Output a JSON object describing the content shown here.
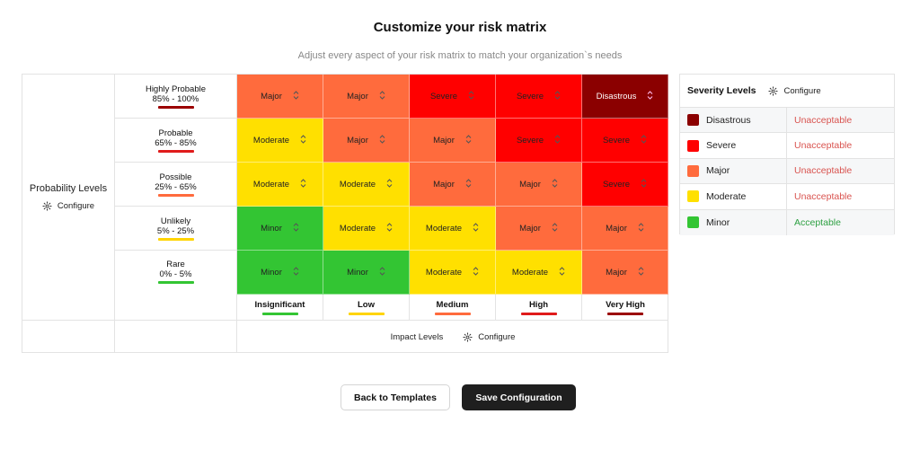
{
  "header": {
    "title": "Customize your risk matrix",
    "subtitle": "Adjust every aspect of your risk matrix to match your organization`s needs"
  },
  "colors": {
    "Disastrous": "#8b0000",
    "Severe": "#ff0000",
    "Major": "#ff6b3d",
    "Moderate": "#ffe000",
    "Minor": "#33c533"
  },
  "probability": {
    "title": "Probability Levels",
    "configure": "Configure",
    "levels": [
      {
        "name": "Highly Probable",
        "range": "85% - 100%",
        "color": "#9b0000"
      },
      {
        "name": "Probable",
        "range": "65% - 85%",
        "color": "#e01b1b"
      },
      {
        "name": "Possible",
        "range": "25% - 65%",
        "color": "#ff6b3d"
      },
      {
        "name": "Unlikely",
        "range": "5% - 25%",
        "color": "#ffd400"
      },
      {
        "name": "Rare",
        "range": "0% - 5%",
        "color": "#33c533"
      }
    ]
  },
  "matrix": {
    "rows": [
      [
        "Major",
        "Major",
        "Severe",
        "Severe",
        "Disastrous"
      ],
      [
        "Moderate",
        "Major",
        "Major",
        "Severe",
        "Severe"
      ],
      [
        "Moderate",
        "Moderate",
        "Major",
        "Major",
        "Severe"
      ],
      [
        "Minor",
        "Moderate",
        "Moderate",
        "Major",
        "Major"
      ],
      [
        "Minor",
        "Minor",
        "Moderate",
        "Moderate",
        "Major"
      ]
    ]
  },
  "impact": {
    "title": "Impact Levels",
    "configure": "Configure",
    "levels": [
      {
        "name": "Insignificant",
        "color": "#33c533"
      },
      {
        "name": "Low",
        "color": "#ffd400"
      },
      {
        "name": "Medium",
        "color": "#ff6b3d"
      },
      {
        "name": "High",
        "color": "#e01b1b"
      },
      {
        "name": "Very High",
        "color": "#9b0000"
      }
    ]
  },
  "severity": {
    "title": "Severity Levels",
    "configure": "Configure",
    "levels": [
      {
        "name": "Disastrous",
        "status": "Unacceptable",
        "color": "#8b0000",
        "status_color": "#d9534f"
      },
      {
        "name": "Severe",
        "status": "Unacceptable",
        "color": "#ff0000",
        "status_color": "#d9534f"
      },
      {
        "name": "Major",
        "status": "Unacceptable",
        "color": "#ff6b3d",
        "status_color": "#d9534f"
      },
      {
        "name": "Moderate",
        "status": "Unacceptable",
        "color": "#ffe000",
        "status_color": "#d9534f"
      },
      {
        "name": "Minor",
        "status": "Acceptable",
        "color": "#33c533",
        "status_color": "#2ea043"
      }
    ]
  },
  "buttons": {
    "back": "Back to Templates",
    "save": "Save Configuration"
  }
}
